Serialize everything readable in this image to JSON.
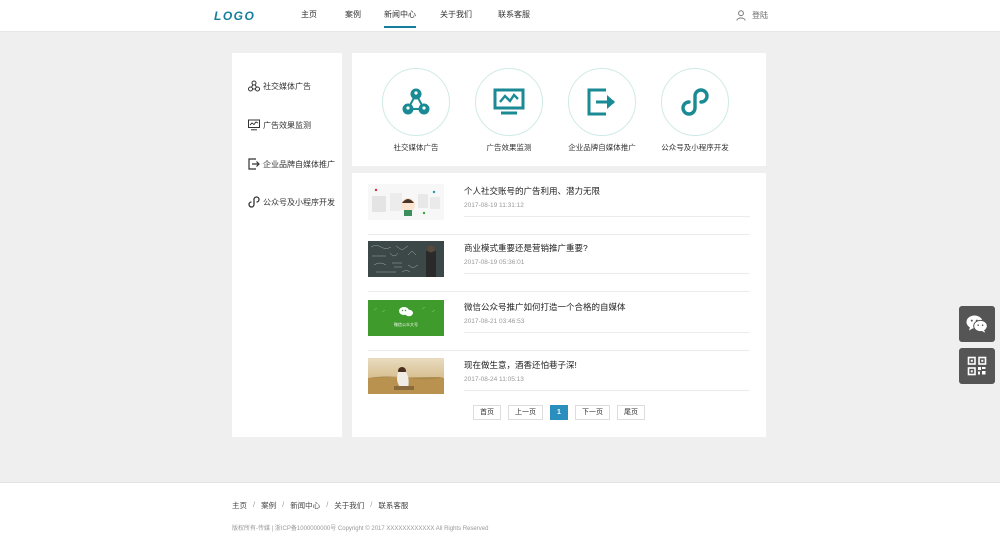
{
  "header": {
    "logo": "LOGO",
    "nav": [
      {
        "label": "主页"
      },
      {
        "label": "案例"
      },
      {
        "label": "新闻中心"
      },
      {
        "label": "关于我们"
      },
      {
        "label": "联系客服"
      }
    ],
    "active_nav": "新闻中心",
    "login_label": "登陆",
    "login_icon": "user-icon"
  },
  "sidebar": {
    "items": [
      {
        "label": "社交媒体广告",
        "icon": "social-share-icon"
      },
      {
        "label": "广告效果监测",
        "icon": "monitor-chart-icon"
      },
      {
        "label": "企业品牌自媒体推广",
        "icon": "export-icon"
      },
      {
        "label": "公众号及小程序开发",
        "icon": "mini-program-icon"
      }
    ]
  },
  "categories": [
    {
      "label": "社交媒体广告",
      "icon": "social-share-icon"
    },
    {
      "label": "广告效果监测",
      "icon": "monitor-chart-icon"
    },
    {
      "label": "企业品牌自媒体推广",
      "icon": "export-icon"
    },
    {
      "label": "公众号及小程序开发",
      "icon": "mini-program-icon"
    }
  ],
  "news": [
    {
      "title": "个人社交账号的广告利用、潜力无限",
      "date": "2017-08-19 11:31:12"
    },
    {
      "title": "商业模式重要还是营销推广重要?",
      "date": "2017-08-19 05:36:01"
    },
    {
      "title": "微信公众号推广如何打造一个合格的自媒体",
      "date": "2017-08-21 03:46:53",
      "thumb_text": "微信公众大号"
    },
    {
      "title": "现在做生意，酒香还怕巷子深!",
      "date": "2017-08-24 11:05:13"
    }
  ],
  "pager": {
    "first": "首页",
    "prev": "上一页",
    "current": "1",
    "next": "下一页",
    "last": "尾页"
  },
  "float_buttons": [
    {
      "icon": "wechat-icon"
    },
    {
      "icon": "qrcode-icon"
    }
  ],
  "footer": {
    "links": [
      "主页",
      "案例",
      "新闻中心",
      "关于我们",
      "联系客服"
    ],
    "separator": "/",
    "copyright": "版权所有-传媒 | 浙ICP备1000000000号 Copyright © 2017 XXXXXXXXXXXX All Rights Reserved"
  },
  "colors": {
    "accent": "#167e9c",
    "icon_teal": "#1a8a94",
    "pager_active": "#2a8fbf",
    "background": "#efefef",
    "float_bg": "#555555"
  }
}
